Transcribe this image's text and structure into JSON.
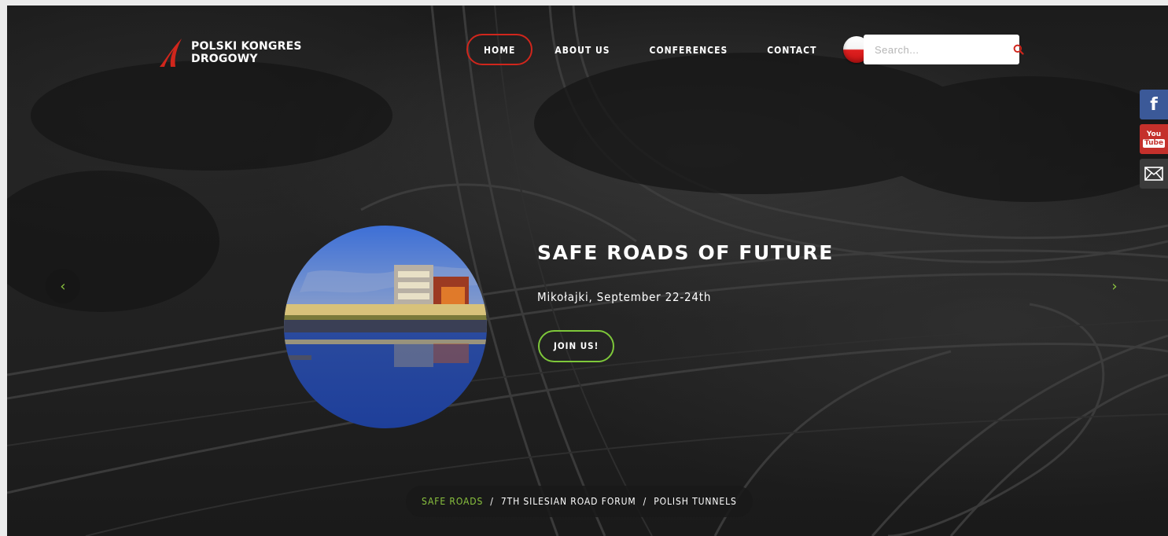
{
  "brand": {
    "line1": "POLSKI KONGRES",
    "line2": "DROGOWY",
    "accent": "#d0261c"
  },
  "nav": {
    "items": [
      {
        "label": "HOME",
        "active": true
      },
      {
        "label": "ABOUT US",
        "active": false
      },
      {
        "label": "CONFERENCES",
        "active": false
      },
      {
        "label": "CONTACT",
        "active": false
      }
    ],
    "language_flag": "poland-flag-icon"
  },
  "search": {
    "placeholder": "Search...",
    "value": "",
    "icon": "search-icon",
    "icon_color": "#d0261c"
  },
  "social": [
    {
      "name": "facebook-icon",
      "color": "#3b5998",
      "glyph": "f"
    },
    {
      "name": "youtube-icon",
      "color": "#c4302b",
      "glyph_top": "You",
      "glyph_bottom": "Tube"
    },
    {
      "name": "mail-icon",
      "color": "#3a3a3a"
    }
  ],
  "slider": {
    "prev_icon": "chevron-left-icon",
    "next_icon": "chevron-right-icon",
    "prev_glyph": "‹",
    "next_glyph": "›",
    "arrow_color": "#8bc43f",
    "slide": {
      "title": "SAFE ROADS OF FUTURE",
      "subtitle": "Mikołajki, September 22-24th",
      "button_label": "JOIN US!",
      "button_color": "#7ec83a"
    }
  },
  "tabs": {
    "items": [
      {
        "label": "SAFE ROADS",
        "active": true
      },
      {
        "label": "7TH SILESIAN ROAD FORUM",
        "active": false
      },
      {
        "label": "POLISH TUNNELS",
        "active": false
      }
    ],
    "separator": "/",
    "active_color": "#8bc43f"
  }
}
